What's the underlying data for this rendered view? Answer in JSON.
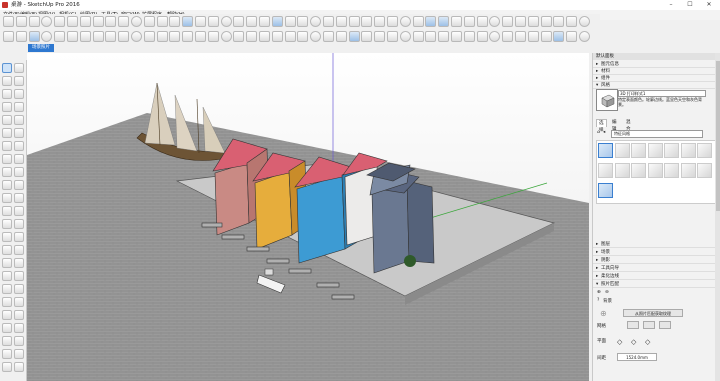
{
  "window": {
    "title": "桌游 - SketchUp Pro 2016",
    "minimize": "–",
    "maximize": "☐",
    "close": "✕"
  },
  "menu": [
    "文件(F)",
    "编辑(E)",
    "视图(V)",
    "相机(C)",
    "绘图(R)",
    "工具(T)",
    "窗口(W)",
    "扩展程序",
    "帮助(H)"
  ],
  "scene_tab": "场景照片",
  "tray": {
    "title": "默认面板",
    "top_sections": [
      "图元信息",
      "材料",
      "组件",
      "风格"
    ],
    "style_name": "3D 打印样式1",
    "style_desc": "特定表面颜色。轮廓边线。蓝显色天空和灰色背景。",
    "tabs": [
      "选择",
      "编辑",
      "混合"
    ],
    "select_value": "特征风格",
    "bottom_sections": [
      "图层",
      "场景",
      "阴影",
      "工具向导",
      "柔化边线",
      "照片匹配"
    ],
    "photo_match": {
      "label": "背景",
      "btn_clear": "从照片匹配获取纹理",
      "label_grid": "网格",
      "label_size": "间距",
      "label_axis": "平面",
      "size_value": "1524.0mm"
    }
  }
}
